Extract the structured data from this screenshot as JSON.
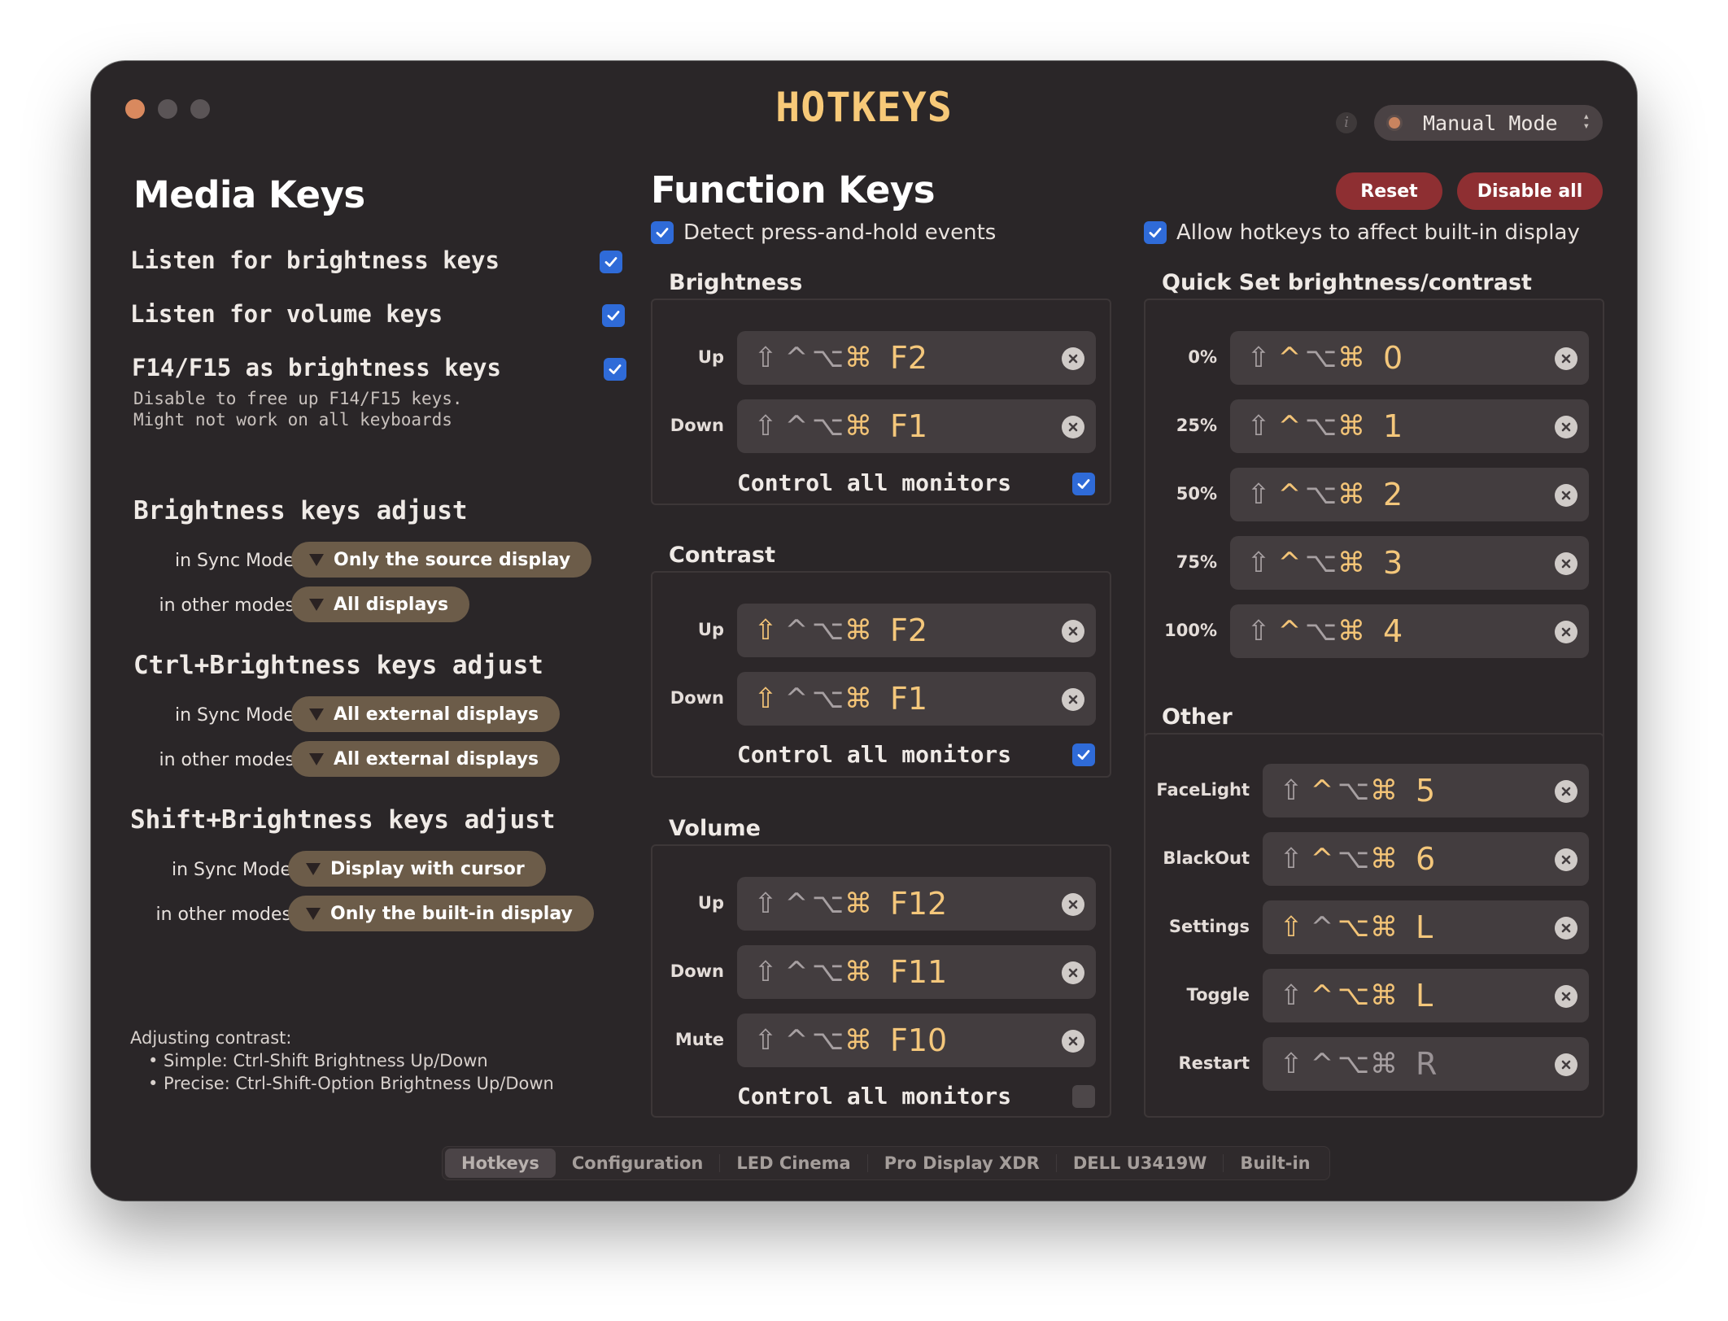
{
  "window": {
    "title": "HOTKEYS",
    "mode_select": {
      "value": "Manual Mode"
    },
    "info_icon": "i"
  },
  "colors": {
    "accent": "#f4c77b",
    "checkbox": "#2f6bd8",
    "pill": "#6c5c49",
    "danger_button": "#8e2f32"
  },
  "media_keys": {
    "heading": "Media Keys",
    "options": [
      {
        "label": "Listen for brightness keys",
        "checked": true
      },
      {
        "label": "Listen for volume keys",
        "checked": true
      },
      {
        "label": "F14/F15 as brightness keys",
        "checked": true,
        "sub": "Disable to free up F14/F15 keys.\nMight not work on all keyboards"
      }
    ],
    "brightness_adjust": {
      "heading": "Brightness keys adjust",
      "sync_label": "in Sync Mode",
      "sync_value": "Only the source display",
      "other_label": "in other modes",
      "other_value": "All displays"
    },
    "ctrl_adjust": {
      "heading": "Ctrl+Brightness keys adjust",
      "sync_label": "in Sync Mode",
      "sync_value": "All external displays",
      "other_label": "in other modes",
      "other_value": "All external displays"
    },
    "shift_adjust": {
      "heading": "Shift+Brightness keys adjust",
      "sync_label": "in Sync Mode",
      "sync_value": "Display with cursor",
      "other_label": "in other modes",
      "other_value": "Only the built-in display"
    },
    "note": {
      "title": "Adjusting contrast:",
      "line1": "• Simple:  Ctrl-Shift Brightness Up/Down",
      "line2": "• Precise: Ctrl-Shift-Option Brightness Up/Down"
    }
  },
  "function_keys": {
    "heading": "Function Keys",
    "reset_label": "Reset",
    "disable_all_label": "Disable all",
    "detect_hold": {
      "label": "Detect press-and-hold events",
      "checked": true
    },
    "allow_builtin": {
      "label": "Allow hotkeys to affect built-in display",
      "checked": true
    },
    "brightness": {
      "title": "Brightness",
      "rows": [
        {
          "label": "Up",
          "mods": [
            "off",
            "off",
            "off",
            "on"
          ],
          "key": "F2"
        },
        {
          "label": "Down",
          "mods": [
            "off",
            "off",
            "off",
            "on"
          ],
          "key": "F1"
        }
      ],
      "control_all": {
        "label": "Control all monitors",
        "checked": true
      }
    },
    "contrast": {
      "title": "Contrast",
      "rows": [
        {
          "label": "Up",
          "mods": [
            "on",
            "off",
            "off",
            "on"
          ],
          "key": "F2"
        },
        {
          "label": "Down",
          "mods": [
            "on",
            "off",
            "off",
            "on"
          ],
          "key": "F1"
        }
      ],
      "control_all": {
        "label": "Control all monitors",
        "checked": true
      }
    },
    "volume": {
      "title": "Volume",
      "rows": [
        {
          "label": "Up",
          "mods": [
            "off",
            "off",
            "off",
            "on"
          ],
          "key": "F12"
        },
        {
          "label": "Down",
          "mods": [
            "off",
            "off",
            "off",
            "on"
          ],
          "key": "F11"
        },
        {
          "label": "Mute",
          "mods": [
            "off",
            "off",
            "off",
            "on"
          ],
          "key": "F10"
        }
      ],
      "control_all": {
        "label": "Control all monitors",
        "checked": false
      }
    },
    "quick_set": {
      "title": "Quick Set brightness/contrast",
      "rows": [
        {
          "label": "0%",
          "mods": [
            "off",
            "on",
            "off",
            "on"
          ],
          "key": "0"
        },
        {
          "label": "25%",
          "mods": [
            "off",
            "on",
            "off",
            "on"
          ],
          "key": "1"
        },
        {
          "label": "50%",
          "mods": [
            "off",
            "on",
            "off",
            "on"
          ],
          "key": "2"
        },
        {
          "label": "75%",
          "mods": [
            "off",
            "on",
            "off",
            "on"
          ],
          "key": "3"
        },
        {
          "label": "100%",
          "mods": [
            "off",
            "on",
            "off",
            "on"
          ],
          "key": "4"
        }
      ]
    },
    "other": {
      "title": "Other",
      "rows": [
        {
          "label": "FaceLight",
          "mods": [
            "off",
            "on",
            "off",
            "on"
          ],
          "key": "5"
        },
        {
          "label": "BlackOut",
          "mods": [
            "off",
            "on",
            "off",
            "on"
          ],
          "key": "6"
        },
        {
          "label": "Settings",
          "mods": [
            "on",
            "off",
            "on",
            "on"
          ],
          "key": "L"
        },
        {
          "label": "Toggle",
          "mods": [
            "off",
            "on",
            "on",
            "on"
          ],
          "key": "L"
        },
        {
          "label": "Restart",
          "mods": [
            "off",
            "off",
            "off",
            "off"
          ],
          "key": "R"
        }
      ]
    }
  },
  "modifier_glyphs": [
    "⇧",
    "^",
    "⌥",
    "⌘"
  ],
  "tabs": [
    "Hotkeys",
    "Configuration",
    "LED Cinema",
    "Pro Display XDR",
    "DELL U3419W",
    "Built-in"
  ],
  "active_tab": "Hotkeys"
}
